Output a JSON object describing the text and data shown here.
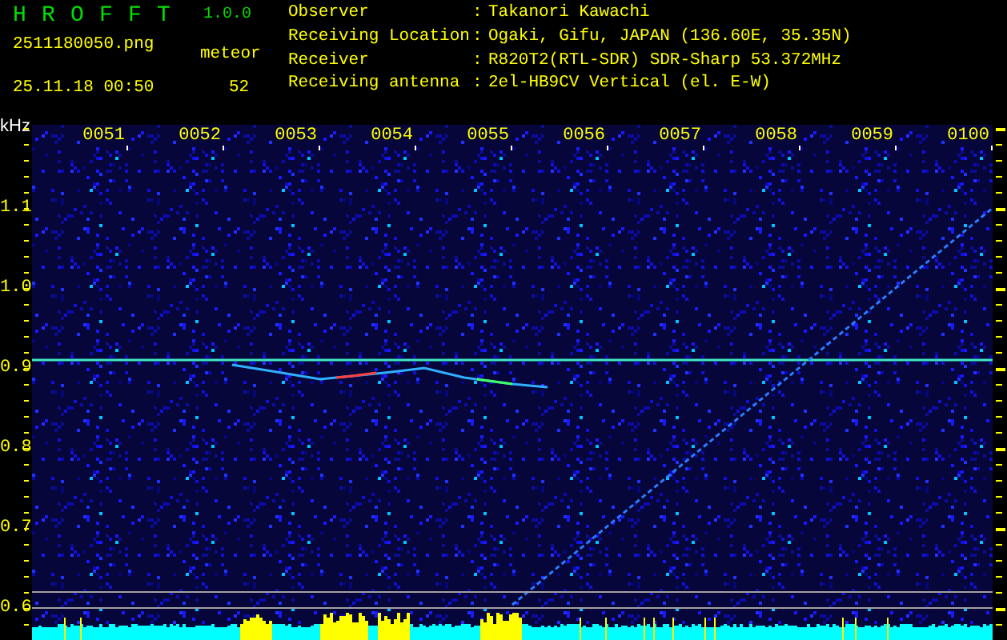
{
  "app": {
    "title": "HROFFT",
    "version": "1.0.0"
  },
  "file": {
    "name": "2511180050.png",
    "datetime": "25.11.18 00:50"
  },
  "meteor": {
    "label": "meteor",
    "count": "52"
  },
  "info": [
    {
      "label": "Observer",
      "separator": ":",
      "value": "Takanori Kawachi"
    },
    {
      "label": "Receiving Location",
      "separator": ":",
      "value": "Ogaki, Gifu, JAPAN (136.60E, 35.35N)"
    },
    {
      "label": "Receiver",
      "separator": ":",
      "value": "R820T2(RTL-SDR) SDR-Sharp 53.372MHz"
    },
    {
      "label": "Receiving antenna",
      "separator": ":",
      "value": "2el-HB9CV Vertical (el. E-W)"
    }
  ],
  "plot": {
    "unit": "kHz",
    "time_labels": [
      "0051",
      "0052",
      "0053",
      "0054",
      "0055",
      "0056",
      "0057",
      "0058",
      "0059",
      "0100"
    ],
    "freq_labels": [
      "1.1",
      "1.0",
      "0.9",
      "0.8",
      "0.7",
      "0.6"
    ]
  }
}
